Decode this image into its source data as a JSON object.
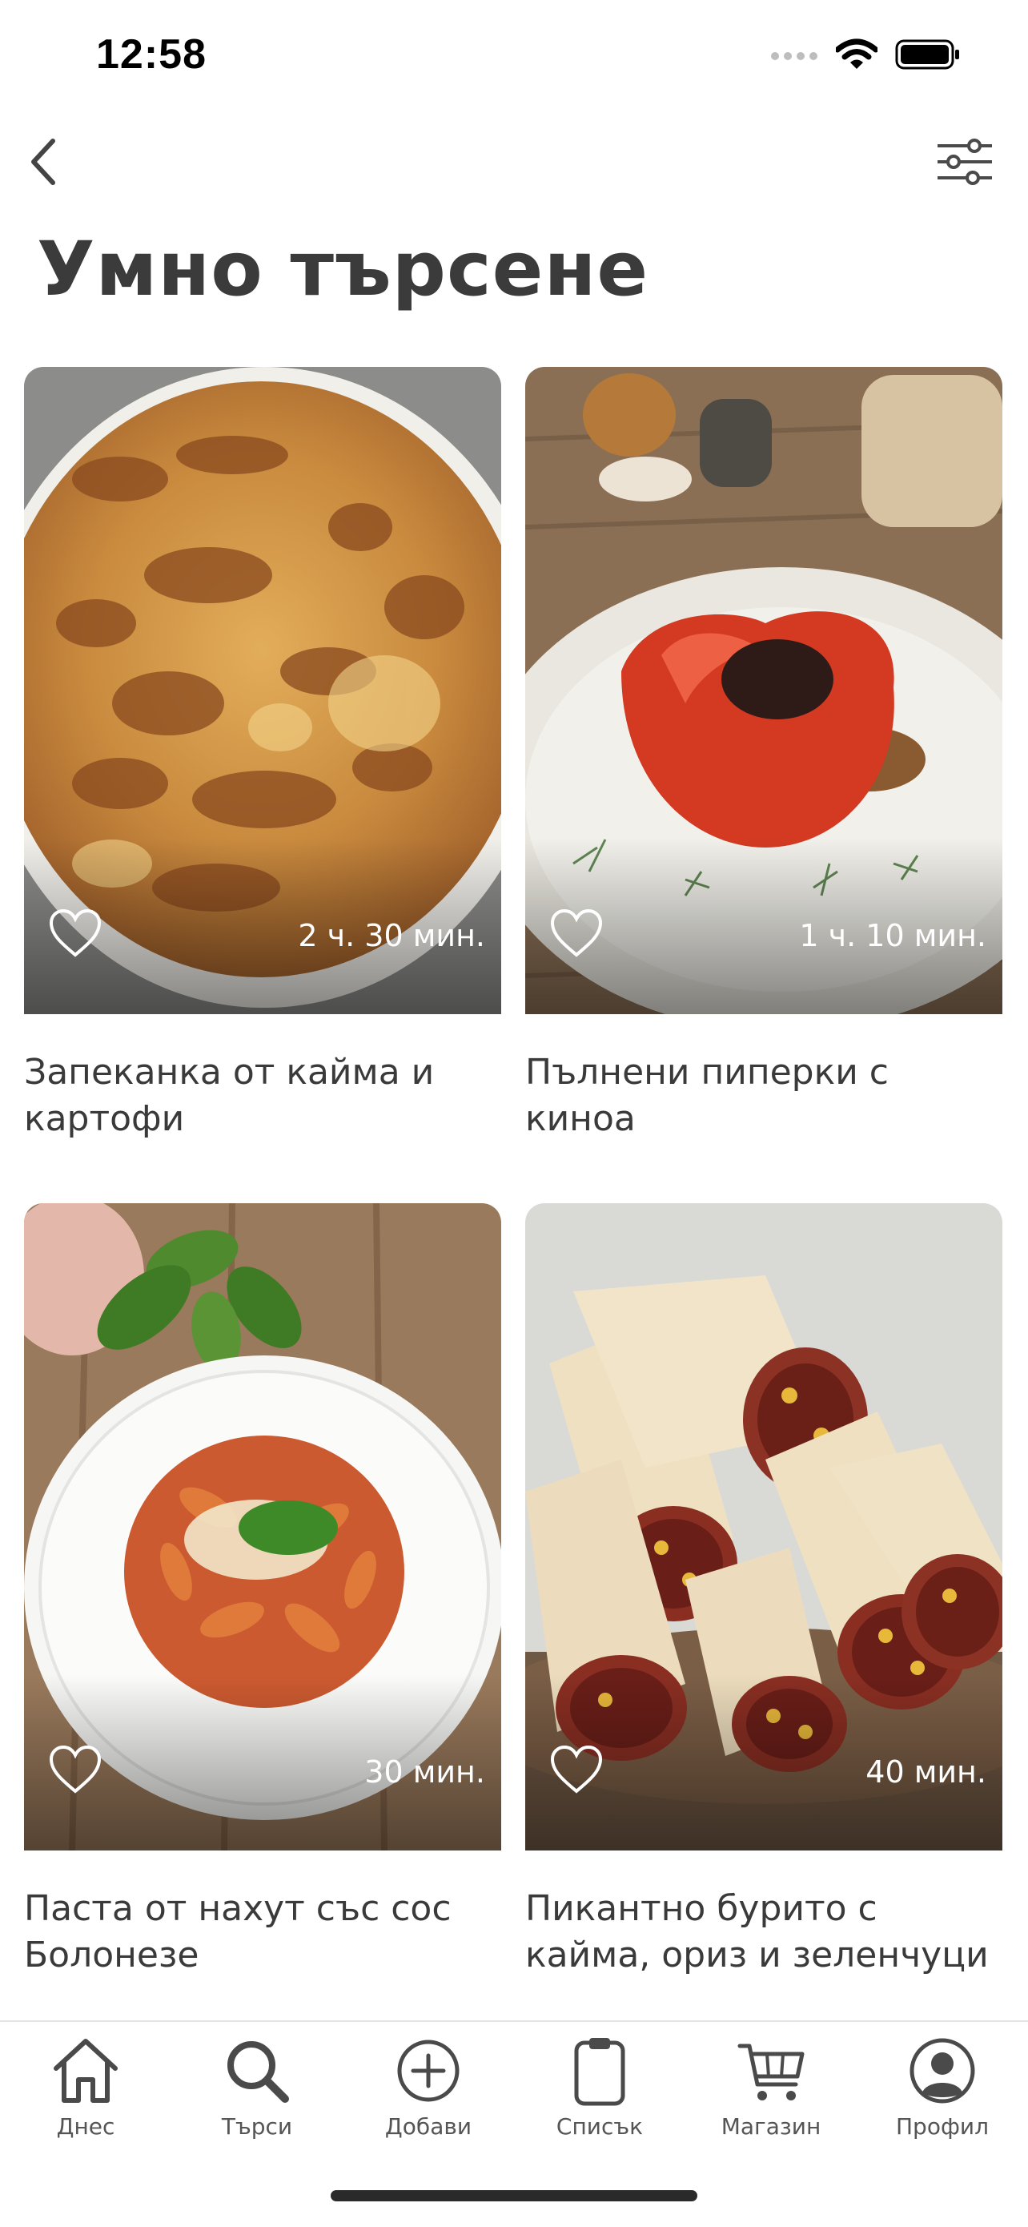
{
  "status_bar": {
    "time": "12:58"
  },
  "header": {
    "title": "Умно търсене",
    "back_icon": "chevron-left-icon",
    "filter_icon": "sliders-icon"
  },
  "recipes": [
    {
      "title": "Запеканка от кайма и\nкартофи",
      "time": "2 ч. 30 мин.",
      "favorite": false
    },
    {
      "title": "Пълнени пиперки с киноа",
      "time": "1 ч. 10 мин.",
      "favorite": false
    },
    {
      "title": "Паста от нахут със сос\nБолонезе",
      "time": "30 мин.",
      "favorite": false
    },
    {
      "title": "Пикантно бурито с\nкайма, ориз и зеленчуци",
      "time": "40 мин.",
      "favorite": false
    }
  ],
  "tab_bar": {
    "items": [
      {
        "label": "Днес",
        "icon": "home-icon"
      },
      {
        "label": "Търси",
        "icon": "search-icon"
      },
      {
        "label": "Добави",
        "icon": "plus-circle-icon"
      },
      {
        "label": "Списък",
        "icon": "clipboard-icon"
      },
      {
        "label": "Магазин",
        "icon": "cart-icon"
      },
      {
        "label": "Профил",
        "icon": "profile-icon"
      }
    ]
  },
  "colors": {
    "text": "#3a3a3a",
    "icon": "#4a4a4a",
    "tab_border": "#e4e4e4"
  }
}
